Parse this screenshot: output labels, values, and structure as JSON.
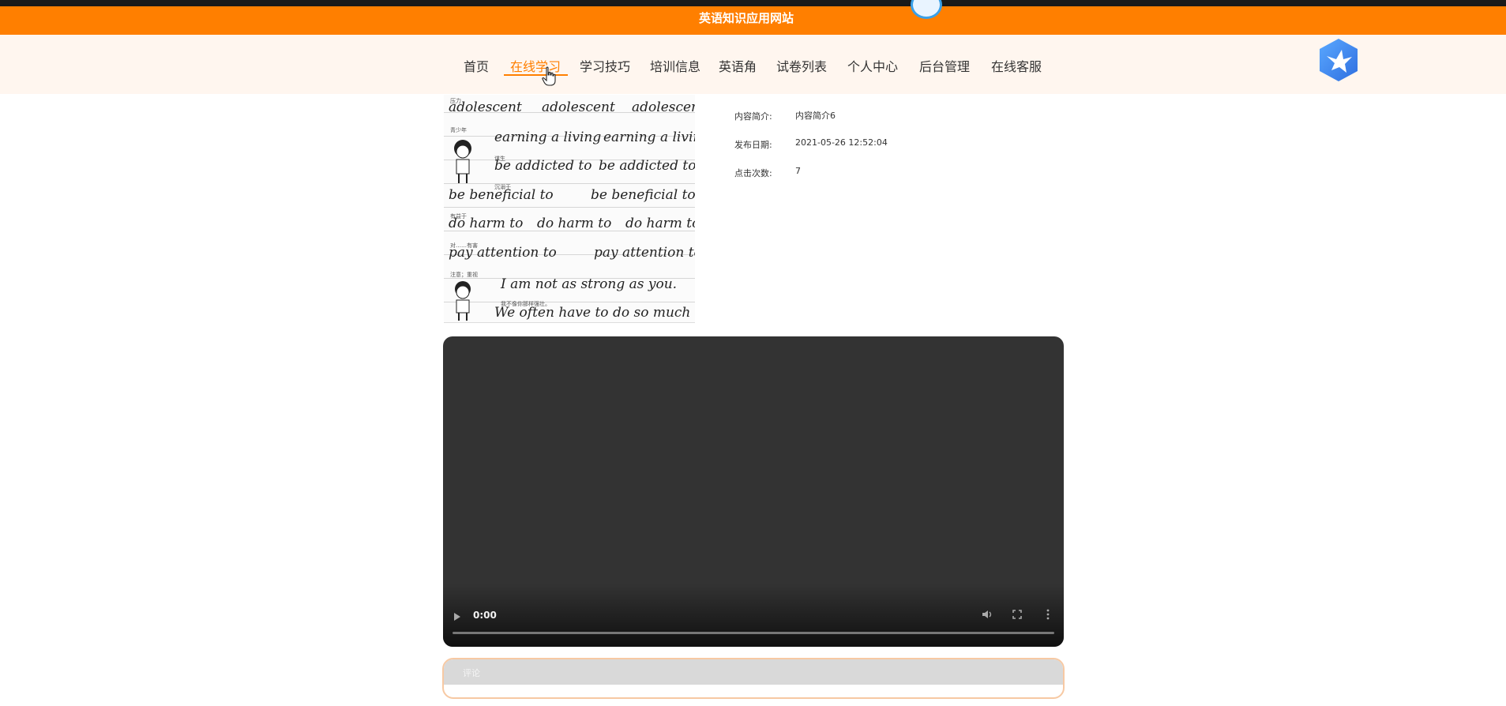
{
  "site": {
    "title": "英语知识应用网站"
  },
  "nav": {
    "items": [
      {
        "label": "首页"
      },
      {
        "label": "在线学习"
      },
      {
        "label": "学习技巧"
      },
      {
        "label": "培训信息"
      },
      {
        "label": "英语角"
      },
      {
        "label": "试卷列表"
      },
      {
        "label": "个人中心"
      },
      {
        "label": "后台管理"
      },
      {
        "label": "在线客服"
      }
    ],
    "active_label": "在线学习"
  },
  "thumbnail": {
    "script_lines": [
      "adolescent",
      "adolescent",
      "adolescent",
      "earning a living",
      "earning a living",
      "be addicted to",
      "be addicted to",
      "be beneficial to",
      "be beneficial to",
      "do harm to",
      "do harm to",
      "do harm to",
      "pay attention to",
      "pay attention to",
      "I am not as strong as you.",
      "We often have to do so much"
    ],
    "hints": [
      "压力",
      "青少年",
      "谋生",
      "沉溺于",
      "有益于",
      "对……有害",
      "注意；重视",
      "我不像你那样强壮。"
    ]
  },
  "details": {
    "summary_label": "内容简介:",
    "summary_value": "内容简介6",
    "date_label": "发布日期:",
    "date_value": "2021-05-26 12:52:04",
    "clicks_label": "点击次数:",
    "clicks_value": "7"
  },
  "video": {
    "time": "0:00",
    "progress": 0
  },
  "comment": {
    "label": "评论"
  },
  "colors": {
    "brand": "#ff7f00",
    "nav_bg": "#fff6ef",
    "video_bg": "#333333"
  },
  "icons": {
    "logo": "hexagon-bird-logo",
    "cursor": "hand-pointer-icon"
  }
}
